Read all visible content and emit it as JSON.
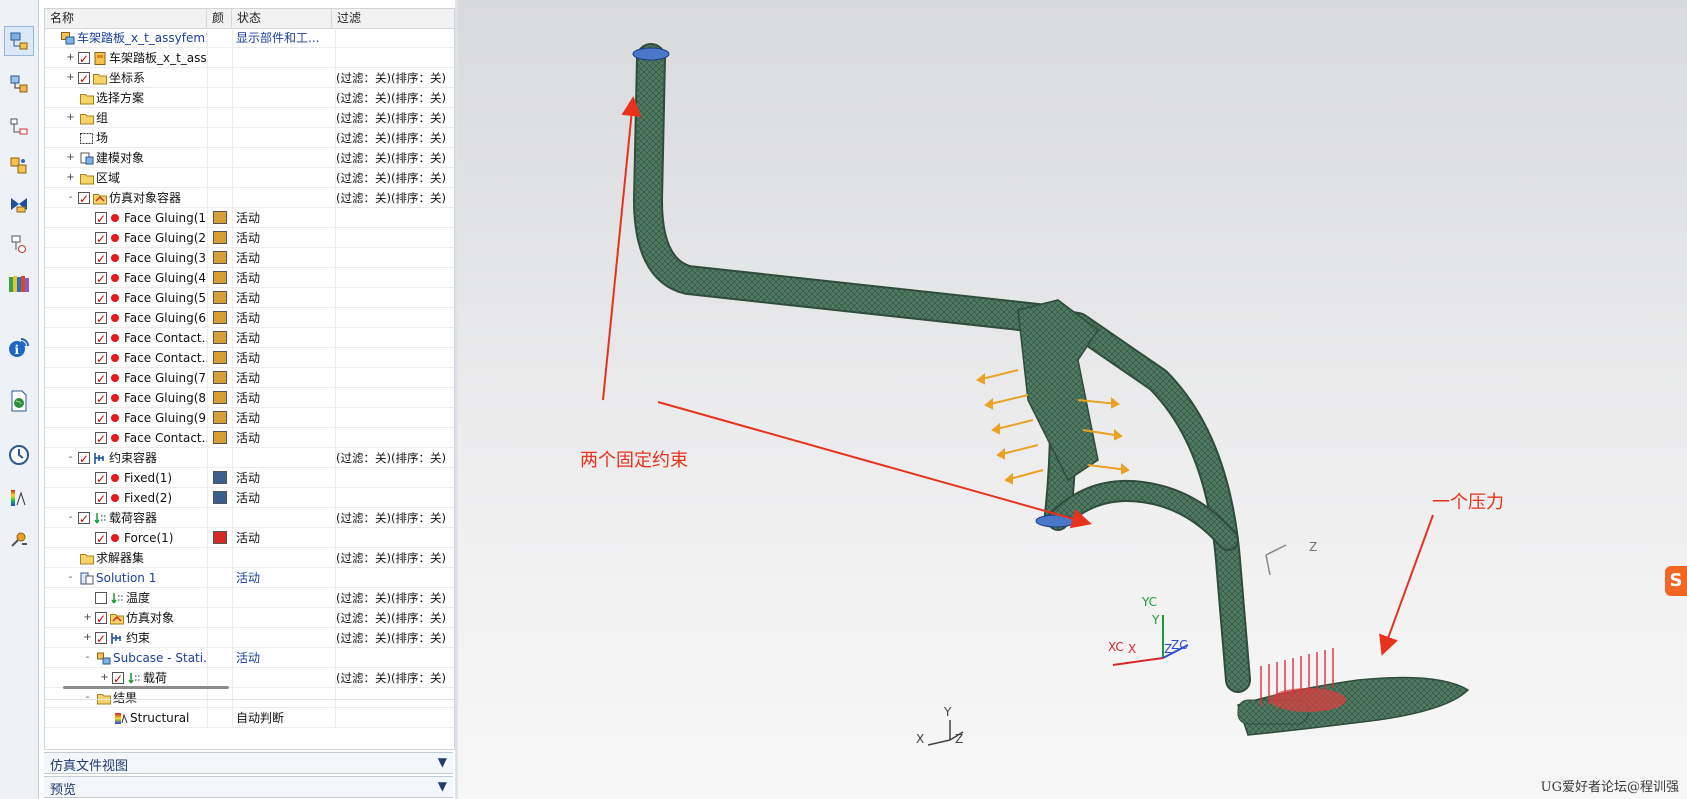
{
  "toolbar": {
    "buttons": [
      "simulation-navigator-icon",
      "fem-navigator-icon",
      "assembly-navigator-icon",
      "part-navigator-icon",
      "constraint-navigator-icon",
      "reuse-library-icon",
      "roles-icon",
      "information-icon",
      "web-browser-icon",
      "history-icon",
      "palette-icon",
      "system-scene-icon"
    ]
  },
  "tree": {
    "columns": {
      "name": "名称",
      "color": "颜",
      "status": "状态",
      "filter": "过滤"
    },
    "rows": [
      {
        "label": "车架踏板_x_t_assyfem1...",
        "status": "显示部件和工...",
        "filter": "",
        "blue": true
      },
      {
        "label": "车架踏板_x_t_ass...",
        "status": "",
        "filter": ""
      },
      {
        "label": "坐标系",
        "status": "",
        "filter": "(过滤：关)(排序：关)"
      },
      {
        "label": "选择方案",
        "status": "",
        "filter": "(过滤：关)(排序：关)"
      },
      {
        "label": "组",
        "status": "",
        "filter": "(过滤：关)(排序：关)"
      },
      {
        "label": "场",
        "status": "",
        "filter": "(过滤：关)(排序：关)"
      },
      {
        "label": "建模对象",
        "status": "",
        "filter": "(过滤：关)(排序：关)"
      },
      {
        "label": "区域",
        "status": "",
        "filter": "(过滤：关)(排序：关)"
      },
      {
        "label": "仿真对象容器",
        "status": "",
        "filter": "(过滤：关)(排序：关)"
      },
      {
        "label": "Face Gluing(1)",
        "status": "活动",
        "filter": ""
      },
      {
        "label": "Face Gluing(2)",
        "status": "活动",
        "filter": ""
      },
      {
        "label": "Face Gluing(3)",
        "status": "活动",
        "filter": ""
      },
      {
        "label": "Face Gluing(4)",
        "status": "活动",
        "filter": ""
      },
      {
        "label": "Face Gluing(5)",
        "status": "活动",
        "filter": ""
      },
      {
        "label": "Face Gluing(6)",
        "status": "活动",
        "filter": ""
      },
      {
        "label": "Face Contact...",
        "status": "活动",
        "filter": ""
      },
      {
        "label": "Face Contact...",
        "status": "活动",
        "filter": ""
      },
      {
        "label": "Face Gluing(7)",
        "status": "活动",
        "filter": ""
      },
      {
        "label": "Face Gluing(8)",
        "status": "活动",
        "filter": ""
      },
      {
        "label": "Face Gluing(9)",
        "status": "活动",
        "filter": ""
      },
      {
        "label": "Face Contact...",
        "status": "活动",
        "filter": ""
      },
      {
        "label": "约束容器",
        "status": "",
        "filter": "(过滤：关)(排序：关)"
      },
      {
        "label": "Fixed(1)",
        "status": "活动",
        "filter": ""
      },
      {
        "label": "Fixed(2)",
        "status": "活动",
        "filter": ""
      },
      {
        "label": "载荷容器",
        "status": "",
        "filter": "(过滤：关)(排序：关)"
      },
      {
        "label": "Force(1)",
        "status": "活动",
        "filter": ""
      },
      {
        "label": "求解器集",
        "status": "",
        "filter": "(过滤：关)(排序：关)"
      },
      {
        "label": "Solution 1",
        "status": "活动",
        "filter": "",
        "blue": true
      },
      {
        "label": "温度",
        "status": "",
        "filter": "(过滤：关)(排序：关)"
      },
      {
        "label": "仿真对象",
        "status": "",
        "filter": "(过滤：关)(排序：关)"
      },
      {
        "label": "约束",
        "status": "",
        "filter": "(过滤：关)(排序：关)"
      },
      {
        "label": "Subcase - Stati...",
        "status": "活动",
        "filter": "",
        "blue": true
      },
      {
        "label": "载荷",
        "status": "",
        "filter": "(过滤：关)(排序：关)"
      },
      {
        "label": "结果",
        "status": "",
        "filter": ""
      },
      {
        "label": "Structural",
        "status": "自动判断",
        "filter": ""
      }
    ],
    "colors": {
      "gluing": "#d6a033",
      "fixed": "#3a5f8f",
      "force": "#d62a2a"
    }
  },
  "panels": {
    "sim_file_view": "仿真文件视图",
    "preview": "预览"
  },
  "viewport": {
    "annotation_fixed": "两个固定约束",
    "annotation_force": "一个压力",
    "triad": {
      "yc": "YC",
      "xc": "XC",
      "zc": "ZC",
      "x": "X",
      "y": "Y",
      "z": "Z"
    },
    "view_triad": {
      "x": "X",
      "y": "Y",
      "z": "Z"
    },
    "part_axis_z": "Z",
    "watermark": "UG爱好者论坛@程训强",
    "colors": {
      "mesh": "#4f7b62",
      "annotation": "#e8321c",
      "glue_arrows": "#e8a322",
      "fixed_markers": "#4b77c9",
      "force_arrows": "#e0303a"
    }
  }
}
